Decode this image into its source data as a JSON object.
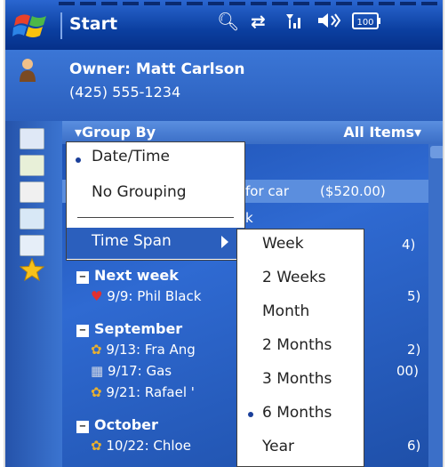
{
  "titlebar": {
    "title": "Start",
    "icons": [
      "search-icon",
      "sync-icon",
      "signal-icon",
      "volume-icon",
      "battery-icon"
    ],
    "battery_text": "100"
  },
  "owner": {
    "name": "Owner: Matt Carlson",
    "phone": "(425) 555-1234"
  },
  "sidebar": {
    "icons": [
      "calendar-icon",
      "tasks-icon",
      "contacts-icon",
      "notes-icon",
      "messaging-icon",
      "favorites-icon"
    ]
  },
  "list": {
    "groupby_label": "Group By",
    "filter_label": "All Items",
    "highlight_text": "for car",
    "highlight_amount": "($520.00)",
    "highlight_partial_row": "k",
    "groups": [
      {
        "label": "Next week",
        "items": [
          {
            "text": "9/9: Phil Black",
            "trail": "5)"
          }
        ]
      },
      {
        "label": "September",
        "items": [
          {
            "text": "9/13: Fra Ang",
            "trail": "2)"
          },
          {
            "text": "9/17: Gas",
            "trail": "00)"
          },
          {
            "text": "9/21: Rafael '",
            "trail": ""
          }
        ]
      },
      {
        "label": "October",
        "items": [
          {
            "text": "10/22: Chloe",
            "trail": "6)"
          }
        ]
      }
    ],
    "row_partial_4": "4)"
  },
  "menu_groupby": {
    "items": [
      "Date/Time",
      "No Grouping"
    ],
    "selected": "Date/Time",
    "submenu_label": "Time Span"
  },
  "menu_timespan": {
    "items": [
      "Week",
      "2 Weeks",
      "Month",
      "2 Months",
      "3 Months",
      "6 Months",
      "Year"
    ],
    "selected": "6 Months"
  },
  "colors": {
    "accent": "#2b5fbd",
    "titlebar": "#0b3fa0",
    "menu_bg": "#ffffff",
    "highlight": "#5b8ede"
  }
}
